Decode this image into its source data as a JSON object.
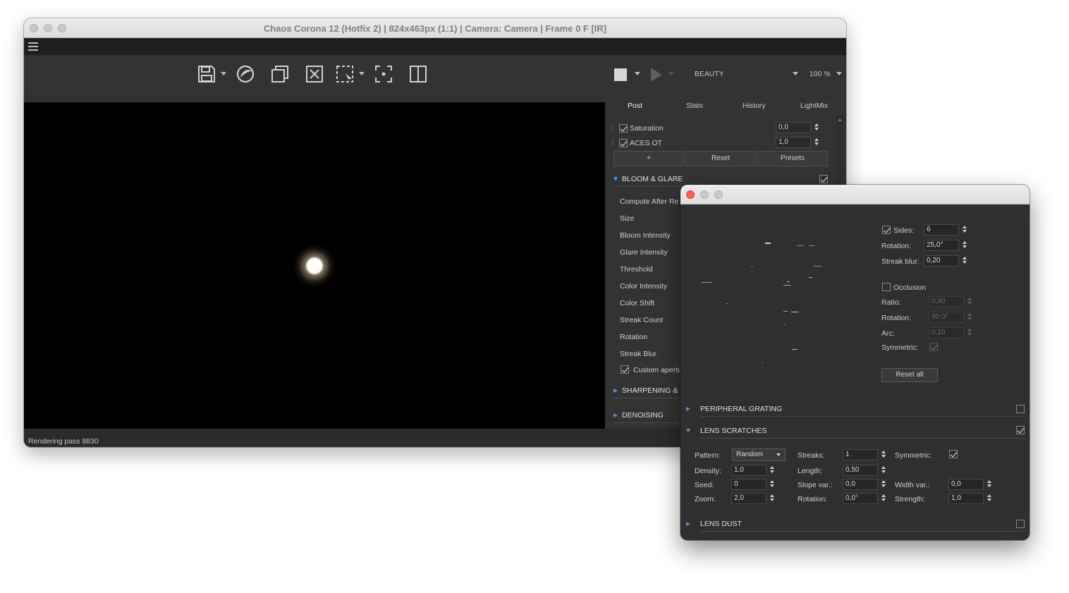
{
  "main_window": {
    "title": "Chaos Corona 12 (Hotfix 2) | 824x463px (1:1) | Camera: Camera | Frame 0 F [IR]",
    "toolbar": {
      "icons": [
        "save-icon",
        "corona-logo-icon",
        "copy-icon",
        "clear-icon",
        "region-select-icon",
        "focus-icon",
        "compare-icon",
        "stop-icon",
        "play-icon"
      ],
      "pass_select": "BEAUTY",
      "zoom": "100 %"
    },
    "status": "Rendering pass 8830",
    "panel": {
      "tabs": [
        "Post",
        "Stats",
        "History",
        "LightMix"
      ],
      "rows": [
        {
          "label": "Saturation",
          "value": "0,0"
        },
        {
          "label": "ACES OT",
          "value": "1,0"
        }
      ],
      "buttons": {
        "add": "+",
        "reset": "Reset",
        "presets": "Presets"
      },
      "bloom": {
        "header": "BLOOM & GLARE",
        "items": [
          "Compute After Re",
          "Size",
          "Bloom Intensity",
          "Glare Intensity",
          "Threshold",
          "Color Intensity",
          "Color Shift",
          "Streak Count",
          "Rotation",
          "Streak Blur"
        ],
        "custom_aperture": "Custom apertu"
      },
      "sharpening": "SHARPENING & B",
      "denoising": "DENOISING"
    }
  },
  "aperture_window": {
    "sides_label": "Sides:",
    "sides": "6",
    "rotation_label": "Rotation:",
    "rotation": "25,0°",
    "streak_blur_label": "Streak blur:",
    "streak_blur": "0,20",
    "occlusion_label": "Occlusion",
    "ratio_label": "Ratio:",
    "ratio": "0,90",
    "occ_rotation_label": "Rotation:",
    "occ_rotation": "90,0°",
    "arc_label": "Arc:",
    "arc": "0,10",
    "symmetric_label": "Symmetric:",
    "reset_all": "Reset all",
    "peripheral_grating": "PERIPHERAL GRATING",
    "lens_scratches": "LENS SCRATCHES",
    "scratches": {
      "pattern_label": "Pattern:",
      "pattern": "Random",
      "density_label": "Density:",
      "density": "1,0",
      "seed_label": "Seed:",
      "seed": "0",
      "zoom_label": "Zoom:",
      "zoom": "2,0",
      "streaks_label": "Streaks:",
      "streaks": "1",
      "length_label": "Length:",
      "length": "0,50",
      "slope_var_label": "Slope var.:",
      "slope_var": "0,0",
      "rotation_label": "Rotation:",
      "rotation": "0,0°",
      "symmetric_label": "Symmetric:",
      "width_var_label": "Width var.:",
      "width_var": "0,0",
      "strength_label": "Strength:",
      "strength": "1,0"
    },
    "lens_dust": "LENS DUST"
  },
  "colors": {
    "accent": "#4e8fd9",
    "close": "#fe5f57",
    "panel_bg": "#333333",
    "window_bg": "#2f2f2f"
  }
}
